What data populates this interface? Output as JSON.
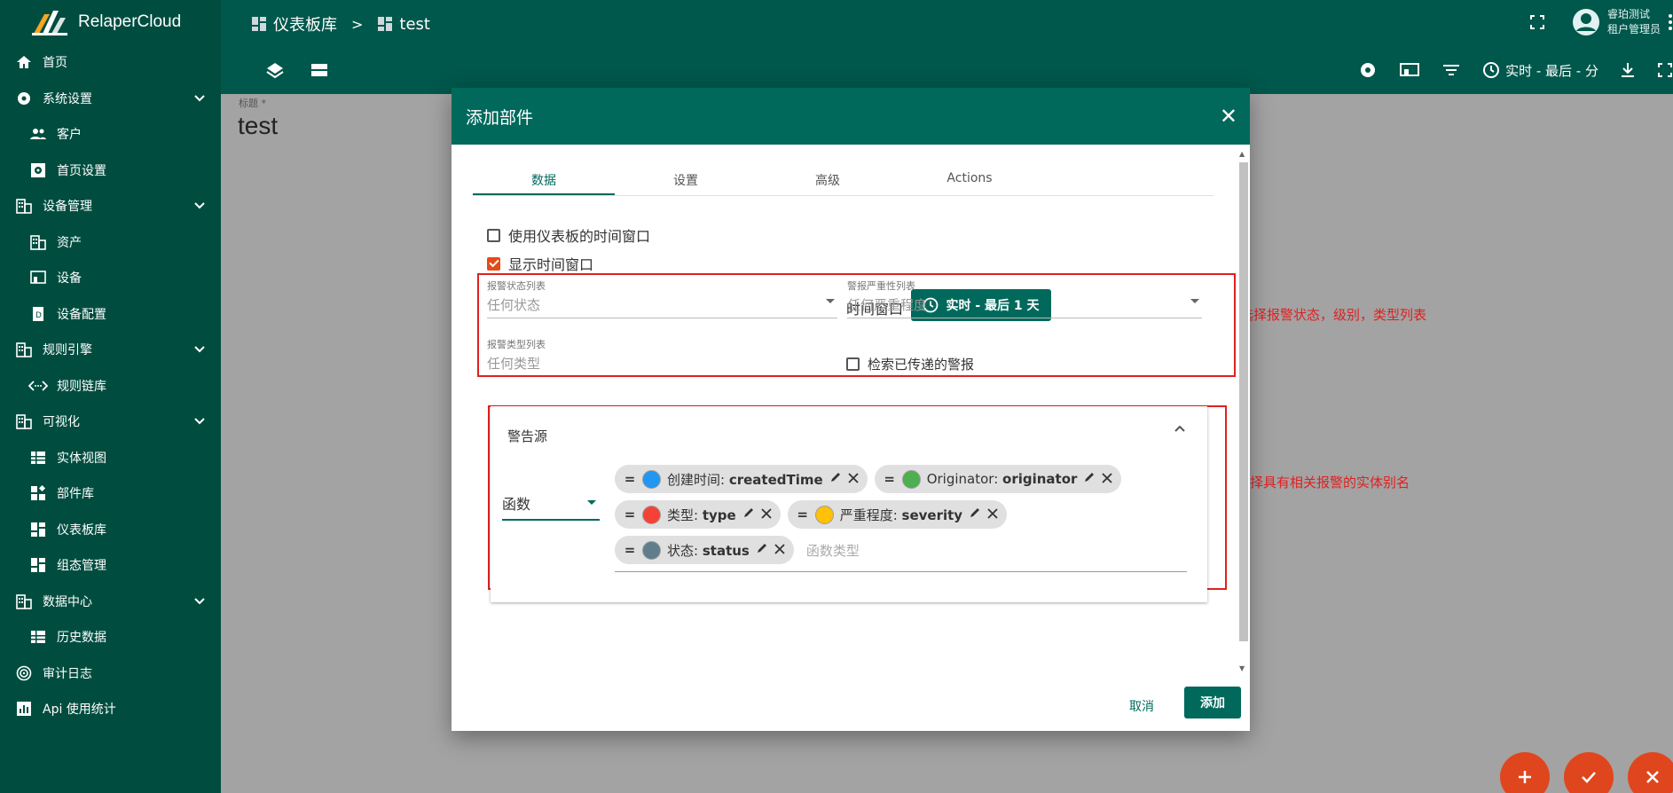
{
  "app": {
    "name": "RelaperCloud"
  },
  "sidebar": {
    "items": [
      {
        "label": "首页",
        "icon": "home-icon",
        "level": 0
      },
      {
        "label": "系统设置",
        "icon": "gear-icon",
        "level": 0,
        "expandable": true
      },
      {
        "label": "客户",
        "icon": "people-icon",
        "level": 1
      },
      {
        "label": "首页设置",
        "icon": "settings-box-icon",
        "level": 1
      },
      {
        "label": "设备管理",
        "icon": "building-icon",
        "level": 0,
        "expandable": true
      },
      {
        "label": "资产",
        "icon": "building-icon",
        "level": 1
      },
      {
        "label": "设备",
        "icon": "device-icon",
        "level": 1
      },
      {
        "label": "设备配置",
        "icon": "device-profile-icon",
        "level": 1
      },
      {
        "label": "规则引擎",
        "icon": "building-icon",
        "level": 0,
        "expandable": true
      },
      {
        "label": "规则链库",
        "icon": "rule-chain-icon",
        "level": 1
      },
      {
        "label": "可视化",
        "icon": "building-icon",
        "level": 0,
        "expandable": true
      },
      {
        "label": "实体视图",
        "icon": "entity-view-icon",
        "level": 1
      },
      {
        "label": "部件库",
        "icon": "widgets-icon",
        "level": 1
      },
      {
        "label": "仪表板库",
        "icon": "dashboard-icon",
        "level": 1
      },
      {
        "label": "组态管理",
        "icon": "dashboard-icon",
        "level": 1
      },
      {
        "label": "数据中心",
        "icon": "building-icon",
        "level": 0,
        "expandable": true
      },
      {
        "label": "历史数据",
        "icon": "entity-view-icon",
        "level": 1
      },
      {
        "label": "审计日志",
        "icon": "track-icon",
        "level": 0
      },
      {
        "label": "Api 使用统计",
        "icon": "chart-icon",
        "level": 0
      }
    ]
  },
  "header": {
    "breadcrumb": {
      "parent": "仪表板库",
      "separator": ">",
      "current": "test"
    },
    "user": {
      "name": "睿珀测试",
      "role": "租户管理员"
    },
    "timewindow_label": "实时 - 最后 - 分"
  },
  "dashboard": {
    "title_label": "标题 *",
    "title": "test"
  },
  "dialog": {
    "title": "添加部件",
    "close_symbol": "✕",
    "tabs": [
      {
        "label": "数据",
        "active": true
      },
      {
        "label": "设置",
        "active": false
      },
      {
        "label": "高级",
        "active": false
      },
      {
        "label": "Actions",
        "active": false
      }
    ],
    "use_dashboard_timewindow": {
      "label": "使用仪表板的时间窗口",
      "checked": false
    },
    "display_timewindow": {
      "label": "显示时间窗口",
      "checked": true
    },
    "timewindow": {
      "label": "时间窗口",
      "button": "实时 - 最后 1 天"
    },
    "alarm_status": {
      "label": "报警状态列表",
      "placeholder": "任何状态"
    },
    "alarm_severity": {
      "label": "警报严重性列表",
      "placeholder": "任何严重程度"
    },
    "alarm_type": {
      "label": "报警类型列表",
      "placeholder": "任何类型"
    },
    "search_propagated": {
      "label": "检索已传递的警报",
      "checked": false
    },
    "alarm_source": {
      "title": "警告源",
      "type_value": "函数",
      "chips": [
        {
          "label": "创建时间",
          "key": "createdTime",
          "color": "#2196f3"
        },
        {
          "label": "Originator",
          "key": "originator",
          "color": "#4caf50"
        },
        {
          "label": "类型",
          "key": "type",
          "color": "#f44336"
        },
        {
          "label": "严重程度",
          "key": "severity",
          "color": "#ffc107"
        },
        {
          "label": "状态",
          "key": "status",
          "color": "#607d8b"
        }
      ],
      "input_placeholder": "函数类型"
    },
    "cancel_label": "取消",
    "add_label": "添加"
  },
  "annotations": {
    "filters_note": "选择报警状态，级别，类型列表",
    "source_note": "选择具有相关报警的实体别名"
  },
  "fabs": [
    "plus-icon",
    "check-icon",
    "close-icon"
  ],
  "colors": {
    "primary": "#00695c",
    "sidebar": "#004d40",
    "topbar": "#00574b",
    "accent": "#e64a19",
    "annotation": "#e02020"
  }
}
